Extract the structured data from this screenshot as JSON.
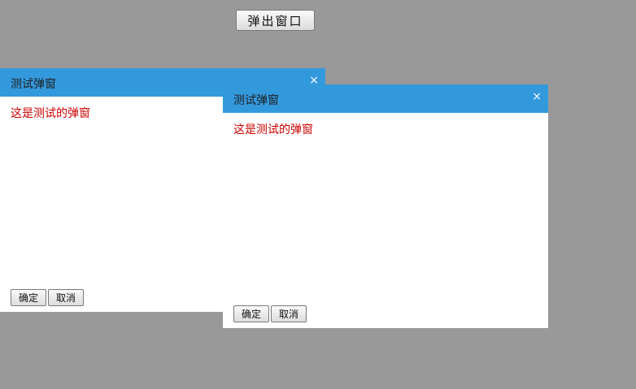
{
  "page": {
    "open_button_label": "弹出窗口",
    "background_color": "#999999"
  },
  "dialogs": [
    {
      "title": "测试弹窗",
      "close_glyph": "×",
      "message": "这是测试的弹窗",
      "confirm_label": "确定",
      "cancel_label": "取消"
    },
    {
      "title": "测试弹窗",
      "close_glyph": "×",
      "message": "这是测试的弹窗",
      "confirm_label": "确定",
      "cancel_label": "取消"
    }
  ],
  "colors": {
    "header": "#3399DD",
    "message_text": "#CC0000",
    "dialog_body": "#FFFFFF"
  },
  "icons": {
    "close": "close-icon"
  }
}
